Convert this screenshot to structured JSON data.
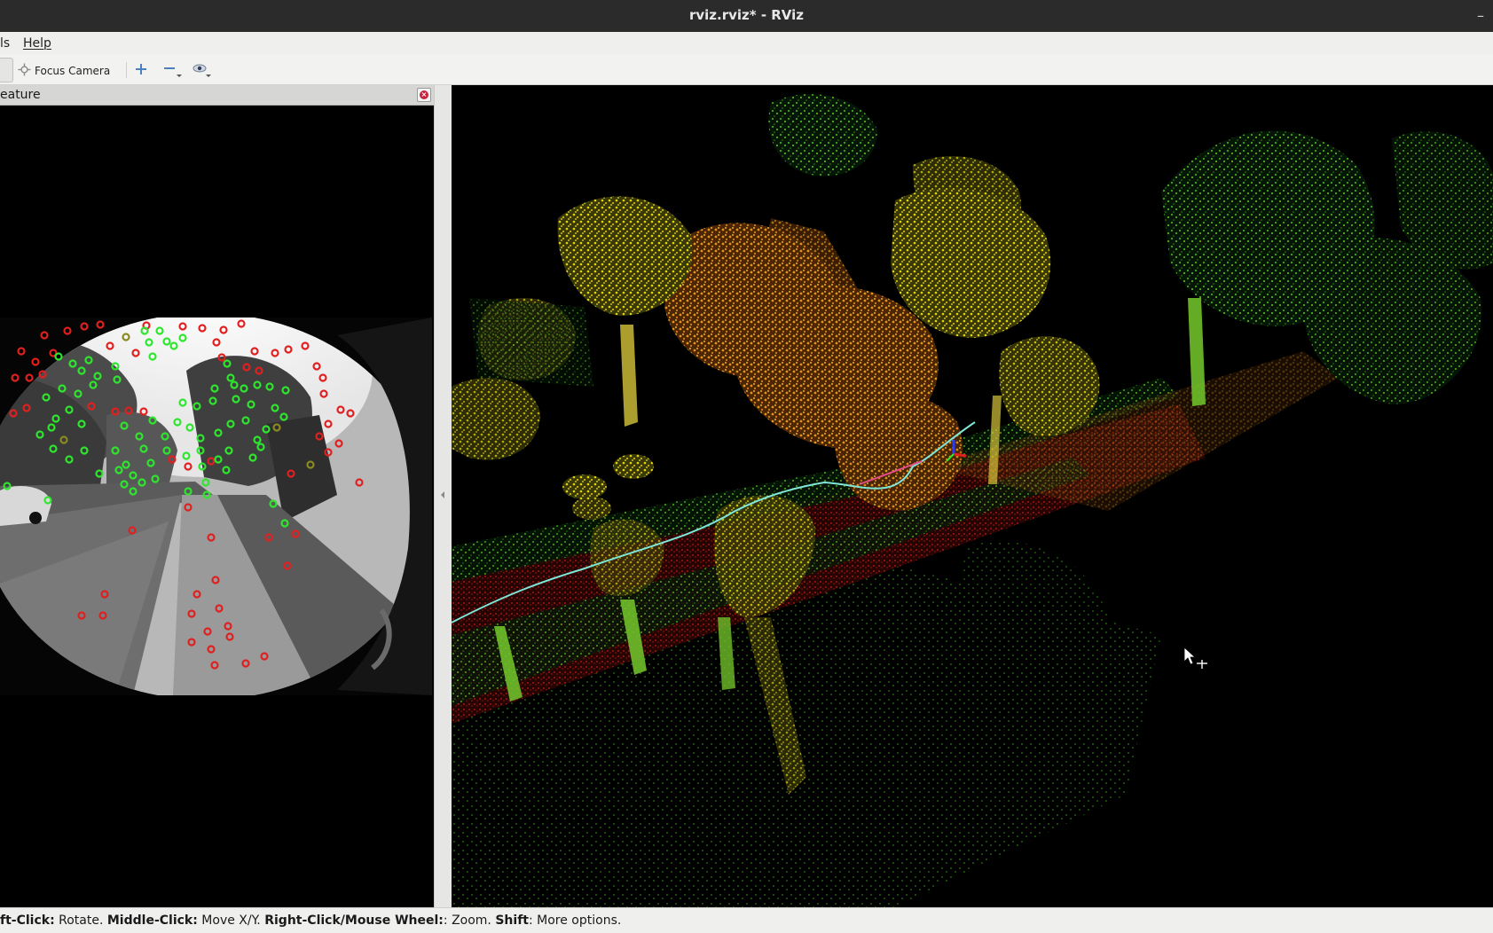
{
  "window": {
    "title": "rviz.rviz* - RViz",
    "minimize_glyph": "–"
  },
  "menu": {
    "tools_fragment": "ls",
    "help": "Help"
  },
  "toolbar": {
    "focus_camera": "Focus Camera",
    "focus_camera_icon": "crosshair-move-icon",
    "zoom_in_icon": "plus-icon",
    "zoom_out_icon": "minus-icon",
    "view_icon": "eye-icon"
  },
  "image_panel": {
    "title": "eature",
    "close_icon": "close-icon"
  },
  "status": {
    "k1": "ft-Click:",
    "v1": " Rotate. ",
    "k2": "Middle-Click:",
    "v2": " Move X/Y. ",
    "k3": "Right-Click/Mouse Wheel:",
    "v3": ": Zoom. ",
    "k4": "Shift",
    "v4": ": More options."
  },
  "colors": {
    "titlebar": "#2b2b2b",
    "trajectory": "#7fe6d8",
    "feature_tracked": "#2ee62e",
    "feature_new": "#e02020",
    "point_yellow": "#d8c21a",
    "point_orange": "#e08a14",
    "point_green": "#3fa81e"
  }
}
